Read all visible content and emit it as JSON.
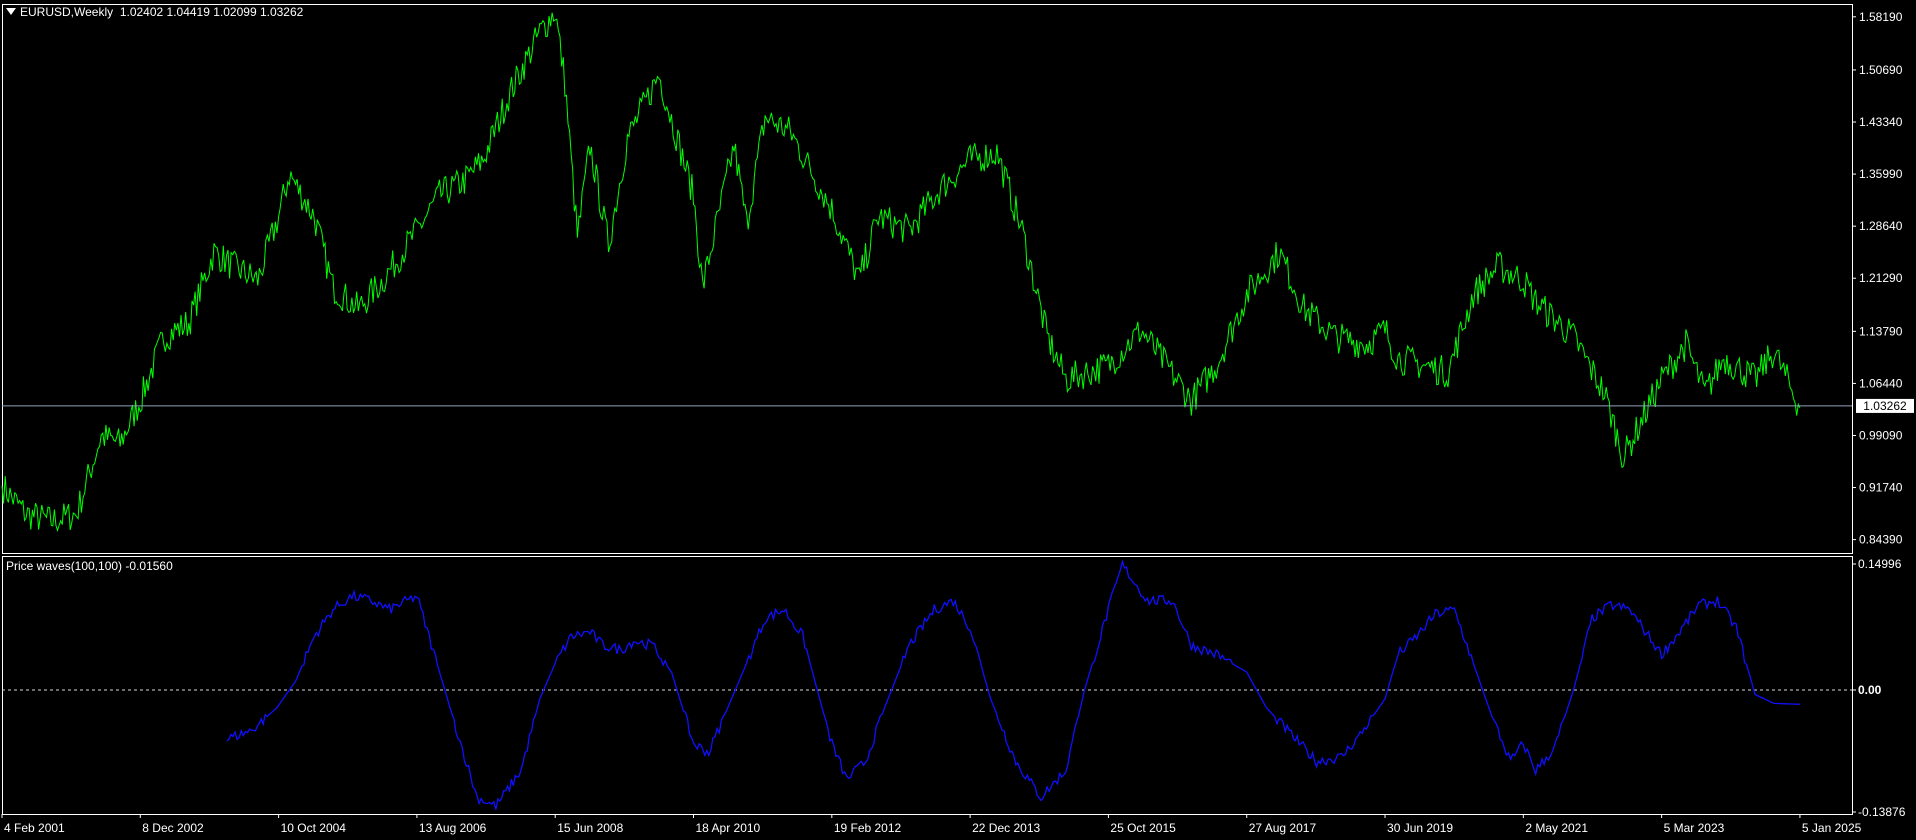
{
  "main_header": {
    "symbol_label": "EURUSD,Weekly",
    "ohlc": "1.02402 1.04419 1.02099 1.03262"
  },
  "indicator_header": {
    "label": "Price waves(100,100)",
    "value": "-0.01560"
  },
  "colors": {
    "background": "#000000",
    "frame": "#ffffff",
    "price_line": "#00ff00",
    "wave_line": "#1010ff",
    "bid_line": "#8fa3b8",
    "zero_line": "#d8d8d8",
    "axis_text": "#ffffff"
  },
  "icons": {
    "menu": "triangle-down-icon"
  },
  "chart_data": [
    {
      "type": "line",
      "title": "EURUSD,Weekly",
      "series": [
        {
          "name": "EURUSD",
          "x": [
            "2001-02-04",
            "2001-06",
            "2001-10",
            "2002-02",
            "2002-06",
            "2002-09",
            "2002-12-08",
            "2003-04",
            "2003-08",
            "2003-12",
            "2004-03",
            "2004-07",
            "2004-10-10",
            "2004-12",
            "2005-04",
            "2005-07",
            "2005-11",
            "2006-03",
            "2006-08-13",
            "2006-12",
            "2007-04",
            "2007-07",
            "2007-11",
            "2008-04",
            "2008-06-15",
            "2008-08",
            "2008-10",
            "2008-12",
            "2009-03",
            "2009-06",
            "2009-11",
            "2010-04-18",
            "2010-06",
            "2010-11",
            "2011-01",
            "2011-04",
            "2011-08",
            "2012-02-19",
            "2012-07",
            "2012-10",
            "2013-03",
            "2013-08",
            "2013-12-22",
            "2014-05",
            "2014-09",
            "2015-01",
            "2015-04",
            "2015-10-25",
            "2016-04",
            "2016-12",
            "2017-04",
            "2017-08-27",
            "2018-02",
            "2018-06",
            "2018-11",
            "2019-04",
            "2019-06-30",
            "2019-09",
            "2020-05",
            "2020-09",
            "2021-01",
            "2021-05-02",
            "2021-07",
            "2022-01",
            "2022-06",
            "2022-09",
            "2023-03-05",
            "2023-07",
            "2023-10",
            "2024-01",
            "2024-06",
            "2024-09",
            "2025-01-05"
          ],
          "y": [
            0.92,
            0.88,
            0.87,
            0.88,
            0.99,
            0.98,
            1.04,
            1.13,
            1.15,
            1.25,
            1.23,
            1.21,
            1.3,
            1.36,
            1.3,
            1.2,
            1.17,
            1.21,
            1.28,
            1.33,
            1.35,
            1.38,
            1.47,
            1.56,
            1.59,
            1.49,
            1.27,
            1.4,
            1.26,
            1.41,
            1.5,
            1.33,
            1.2,
            1.4,
            1.29,
            1.44,
            1.42,
            1.31,
            1.21,
            1.3,
            1.28,
            1.34,
            1.38,
            1.39,
            1.28,
            1.13,
            1.07,
            1.09,
            1.14,
            1.04,
            1.09,
            1.19,
            1.25,
            1.17,
            1.13,
            1.12,
            1.14,
            1.1,
            1.08,
            1.19,
            1.23,
            1.21,
            1.18,
            1.13,
            1.05,
            0.96,
            1.07,
            1.12,
            1.05,
            1.1,
            1.07,
            1.11,
            1.03
          ]
        }
      ],
      "last_value": "1.03262",
      "y_ticks": [
        "1.58190",
        "1.50690",
        "1.43340",
        "1.35990",
        "1.28640",
        "1.21290",
        "1.13790",
        "1.06440",
        "0.99090",
        "0.91740",
        "0.84390"
      ],
      "ylim": [
        0.825,
        1.6
      ],
      "xlim": [
        "2001-02-04",
        "2025-09-15"
      ],
      "grid": false
    },
    {
      "type": "line",
      "title": "Price waves(100,100)",
      "series": [
        {
          "name": "Price waves",
          "x": [
            "2004-02",
            "2004-06",
            "2004-10",
            "2005-01",
            "2005-04",
            "2005-07",
            "2005-10",
            "2006-01",
            "2006-04",
            "2006-08-13",
            "2006-12",
            "2007-03",
            "2007-06",
            "2007-09",
            "2008-01",
            "2008-04",
            "2008-06-15",
            "2008-09",
            "2008-12",
            "2009-02",
            "2009-05",
            "2009-07",
            "2009-10",
            "2010-01",
            "2010-04-18",
            "2010-07",
            "2010-10",
            "2011-01",
            "2011-04",
            "2011-07",
            "2011-10",
            "2012-02-19",
            "2012-05",
            "2012-08",
            "2012-11",
            "2013-03",
            "2013-07",
            "2013-10",
            "2013-12-22",
            "2014-04",
            "2014-08",
            "2014-12",
            "2015-04",
            "2015-07",
            "2015-10-25",
            "2016-01",
            "2016-05",
            "2016-09",
            "2016-12",
            "2017-04",
            "2017-08-27",
            "2017-12",
            "2018-04",
            "2018-08",
            "2018-12",
            "2019-03",
            "2019-06-30",
            "2019-09",
            "2019-12",
            "2020-03",
            "2020-06",
            "2020-09",
            "2020-12",
            "2021-03",
            "2021-05-02",
            "2021-07",
            "2021-10",
            "2022-01",
            "2022-04",
            "2022-07",
            "2022-10",
            "2023-01",
            "2023-03-05",
            "2023-06",
            "2023-09",
            "2023-12",
            "2024-03",
            "2024-06",
            "2024-09",
            "2025-01-05"
          ],
          "y": [
            -0.055,
            -0.045,
            -0.02,
            0.01,
            0.06,
            0.09,
            0.105,
            0.1,
            0.09,
            0.105,
            0.02,
            -0.05,
            -0.12,
            -0.13,
            -0.09,
            -0.01,
            0.03,
            0.06,
            0.065,
            0.05,
            0.045,
            0.055,
            0.05,
            0.02,
            -0.06,
            -0.07,
            -0.02,
            0.03,
            0.08,
            0.09,
            0.06,
            -0.06,
            -0.1,
            -0.08,
            -0.02,
            0.05,
            0.09,
            0.1,
            0.07,
            -0.01,
            -0.08,
            -0.12,
            -0.09,
            0.0,
            0.09,
            0.14,
            0.1,
            0.1,
            0.05,
            0.04,
            0.02,
            -0.02,
            -0.05,
            -0.08,
            -0.075,
            -0.05,
            -0.01,
            0.04,
            0.06,
            0.085,
            0.09,
            0.03,
            -0.03,
            -0.08,
            -0.06,
            -0.09,
            -0.065,
            0.0,
            0.08,
            0.095,
            0.09,
            0.06,
            0.04,
            0.065,
            0.095,
            0.1,
            0.07,
            -0.005,
            -0.015,
            -0.016
          ]
        }
      ],
      "y_ticks": [
        "0.14996",
        "0.00",
        "-0.13876"
      ],
      "ylim": [
        -0.13876,
        0.14996
      ],
      "zero_line": 0,
      "grid": false
    }
  ],
  "x_axis_labels": [
    "4 Feb 2001",
    "8 Dec 2002",
    "10 Oct 2004",
    "13 Aug 2006",
    "15 Jun 2008",
    "18 Apr 2010",
    "19 Feb 2012",
    "22 Dec 2013",
    "25 Oct 2015",
    "27 Aug 2017",
    "30 Jun 2019",
    "2 May 2021",
    "5 Mar 2023",
    "5 Jan 2025"
  ],
  "x_axis_dates": [
    "2001-02-04",
    "2002-12-08",
    "2004-10-10",
    "2006-08-13",
    "2008-06-15",
    "2010-04-18",
    "2012-02-19",
    "2013-12-22",
    "2015-10-25",
    "2017-08-27",
    "2019-06-30",
    "2021-05-02",
    "2023-03-05",
    "2025-01-05"
  ]
}
